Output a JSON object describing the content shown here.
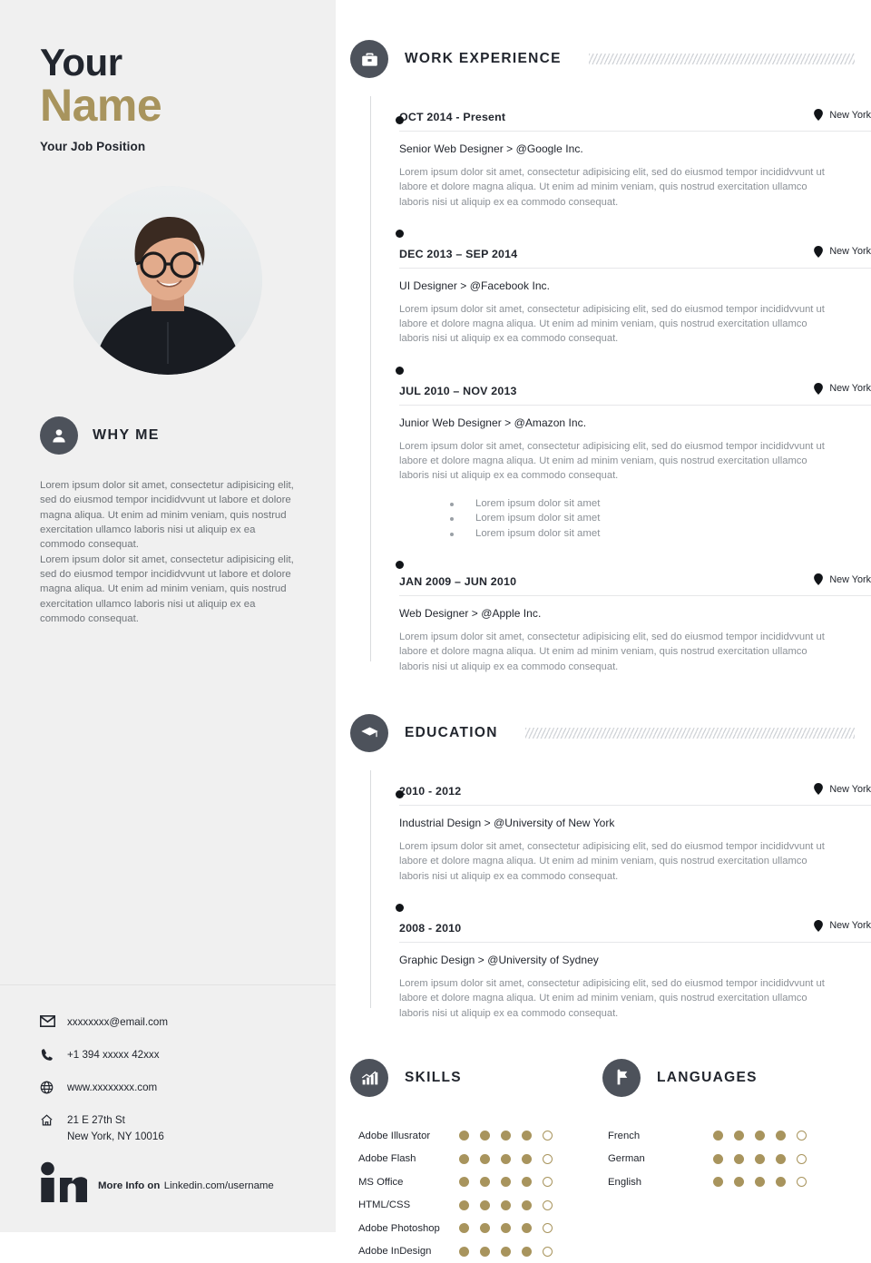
{
  "theme": {
    "gold": "#a8945d",
    "dark": "#22262e",
    "circle": "#4d525b",
    "panel_bg": "#f0f0f0",
    "muted": "#8b9096"
  },
  "left": {
    "name_first": "Your",
    "name_last": "Name",
    "job_position": "Your Job Position",
    "why_me": {
      "title": "WHY ME",
      "icon": "user-icon",
      "paragraphs": [
        "Lorem ipsum dolor sit amet, consectetur adipisicing elit, sed do eiusmod tempor incididvvunt ut labore et dolore magna aliqua. Ut enim ad minim veniam, quis nostrud exercitation ullamco laboris nisi ut aliquip ex ea commodo consequat.",
        "Lorem ipsum dolor sit amet, consectetur adipisicing elit, sed do eiusmod tempor incididvvunt ut labore et dolore magna aliqua. Ut enim ad minim veniam, quis nostrud exercitation ullamco laboris nisi ut aliquip ex ea commodo consequat."
      ]
    },
    "contacts": [
      {
        "icon": "envelope-icon",
        "value": "xxxxxxxx@email.com"
      },
      {
        "icon": "phone-icon",
        "value": "+1 394 xxxxx  42xxx"
      },
      {
        "icon": "globe-icon",
        "value": "www.xxxxxxxx.com"
      },
      {
        "icon": "home-icon",
        "value": "21 E 27th St",
        "value2": "New York, NY 10016"
      }
    ],
    "linkedin": {
      "icon": "linkedin-icon",
      "title": "More Info on",
      "url": "Linkedin.com/username"
    }
  },
  "work": {
    "title": "WORK EXPERIENCE",
    "icon": "briefcase-icon",
    "entries": [
      {
        "date": "OCT 2014 - Present",
        "location": "New York",
        "role": "Senior Web Designer > @Google Inc.",
        "description": "Lorem ipsum dolor sit amet, consectetur adipisicing elit, sed do eiusmod tempor incididvvunt ut labore et dolore magna aliqua. Ut enim ad minim veniam, quis nostrud exercitation ullamco laboris nisi ut aliquip ex ea commodo consequat.",
        "bullets": []
      },
      {
        "date": "DEC 2013 – SEP 2014",
        "location": "New York",
        "role": "UI Designer > @Facebook Inc.",
        "description": "Lorem ipsum dolor sit amet, consectetur adipisicing elit, sed do eiusmod tempor incididvvunt ut labore et dolore magna aliqua. Ut enim ad minim veniam, quis nostrud exercitation ullamco laboris nisi ut aliquip ex ea commodo consequat.",
        "bullets": []
      },
      {
        "date": "JUL 2010 – NOV 2013",
        "location": "New York",
        "role": "Junior Web Designer > @Amazon Inc.",
        "description": "Lorem ipsum dolor sit amet, consectetur adipisicing elit, sed do eiusmod tempor incididvvunt ut labore et dolore magna aliqua. Ut enim ad minim veniam, quis nostrud exercitation ullamco laboris nisi ut aliquip ex ea commodo consequat.",
        "bullets": [
          "Lorem ipsum dolor sit amet",
          "Lorem ipsum dolor sit amet",
          "Lorem ipsum dolor sit amet"
        ]
      },
      {
        "date": "JAN 2009 – JUN 2010",
        "location": "New York",
        "role": "Web Designer > @Apple Inc.",
        "description": "Lorem ipsum dolor sit amet, consectetur adipisicing elit, sed do eiusmod tempor incididvvunt ut labore et dolore magna aliqua. Ut enim ad minim veniam, quis nostrud exercitation ullamco laboris nisi ut aliquip ex ea commodo consequat.",
        "bullets": []
      }
    ]
  },
  "education": {
    "title": "EDUCATION",
    "icon": "graduation-cap-icon",
    "entries": [
      {
        "date": "2010 - 2012",
        "location": "New York",
        "role": "Industrial Design > @University of New York",
        "description": "Lorem ipsum dolor sit amet, consectetur adipisicing elit, sed do eiusmod tempor incididvvunt ut labore et dolore magna aliqua. Ut enim ad minim veniam, quis nostrud exercitation ullamco laboris nisi ut aliquip ex ea commodo consequat.",
        "bullets": []
      },
      {
        "date": "2008 - 2010",
        "location": "New York",
        "role": "Graphic Design > @University of Sydney",
        "description": "Lorem ipsum dolor sit amet, consectetur adipisicing elit, sed do eiusmod tempor incididvvunt ut labore et dolore magna aliqua. Ut enim ad minim veniam, quis nostrud exercitation ullamco laboris nisi ut aliquip ex ea commodo consequat.",
        "bullets": []
      }
    ]
  },
  "skills": {
    "title": "SKILLS",
    "icon": "bar-chart-icon",
    "max": 5,
    "items": [
      {
        "label": "Adobe Illusrator",
        "value": 4
      },
      {
        "label": "Adobe Flash",
        "value": 4
      },
      {
        "label": "MS Office",
        "value": 4
      },
      {
        "label": "HTML/CSS",
        "value": 4
      },
      {
        "label": "Adobe Photoshop",
        "value": 4
      },
      {
        "label": "Adobe InDesign",
        "value": 4
      }
    ]
  },
  "languages": {
    "title": "LANGUAGES",
    "icon": "flag-icon",
    "max": 5,
    "items": [
      {
        "label": "French",
        "value": 4
      },
      {
        "label": "German",
        "value": 4
      },
      {
        "label": "English",
        "value": 4
      }
    ]
  }
}
